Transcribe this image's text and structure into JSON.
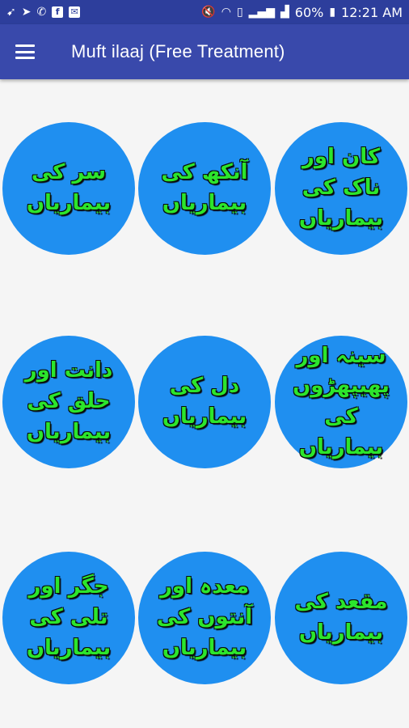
{
  "status": {
    "battery": "60%",
    "time": "12:21 AM"
  },
  "toolbar": {
    "title": "Muft ilaaj (Free Treatment)"
  },
  "colors": {
    "statusbar": "#2d3e9c",
    "toolbar": "#3949ab",
    "circle": "#1f8ff0",
    "circle_text": "#2ce52c"
  },
  "tiles": [
    {
      "label": "سر کی بیماریاں"
    },
    {
      "label": "آنکھ کی بیماریاں"
    },
    {
      "label": "کان اور ناک کی بیماریاں"
    },
    {
      "label": "دانت اور حلق کی بیماریاں"
    },
    {
      "label": "دل کی بیماریاں"
    },
    {
      "label": "سینہ اور پھیپھڑوں کی بیماریاں"
    },
    {
      "label": "جگر اور تلی کی بیماریاں"
    },
    {
      "label": "معدہ اور آنتوں کی بیماریاں"
    },
    {
      "label": "مقعد کی بیماریاں"
    }
  ]
}
